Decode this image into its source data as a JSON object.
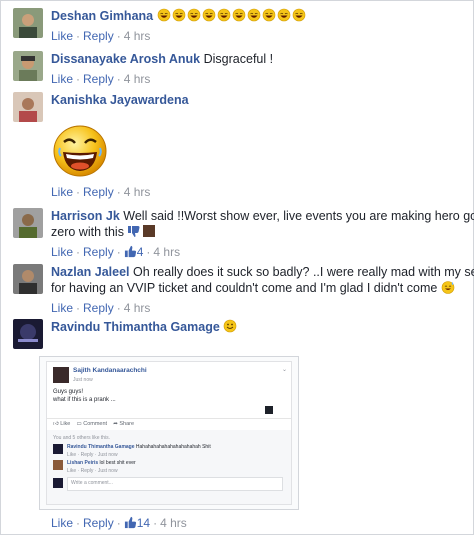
{
  "comments": [
    {
      "name": "Deshan Gimhana",
      "text": "",
      "emoji_count": 10,
      "time": "4 hrs"
    },
    {
      "name": "Dissanayake Arosh Anuk",
      "text": "Disgraceful !",
      "time": "4 hrs"
    },
    {
      "name": "Kanishka Jayawardena",
      "text": "",
      "time": "4 hrs"
    },
    {
      "name": "Harrison Jk",
      "text_line1": "Well said !!Worst show ever, live events you are making hero go",
      "text_line2": "zero with this",
      "likes": "4",
      "time": "4 hrs"
    },
    {
      "name": "Nazlan Jaleel",
      "text_line1": "Oh really does it suck so badly? ..I were really mad with my self",
      "text_line2": "for having an VVIP ticket and couldn't come and I'm glad I didn't come",
      "time": "4 hrs"
    },
    {
      "name": "Ravindu Thimantha Gamage",
      "text": "",
      "likes": "14",
      "time": "4 hrs"
    }
  ],
  "actions": {
    "like": "Like",
    "reply": "Reply",
    "dot": "·"
  },
  "avatar_colors": [
    "#3b4a3a",
    "#6b7b5a",
    "#b34a4a",
    "#556b2f",
    "#2f2f2f",
    "#1a1a33"
  ],
  "embedded_post": {
    "author": "Sajith Kandanaarachchi",
    "meta": "Just now",
    "line1": "Guys guys!",
    "line2": "what if this is a prank ...",
    "like": "Like",
    "comment": "Comment",
    "share": "Share",
    "likers": "You and 5 others like this.",
    "reply1_name": "Ravindu Thimantha Gamage",
    "reply1_text": "Hahahahahahahahahahahah",
    "reply1_extra": "Shit",
    "reply1_meta": "Like · Reply · Just now",
    "reply2_name": "Lishan Peiris",
    "reply2_text": "lol best shit ever",
    "reply2_meta": "Like · Reply · Just now",
    "write_placeholder": "Write a comment..."
  },
  "icons": {
    "smiley": "smiley-icon",
    "thumbs_up": "thumbs-up-icon",
    "thumbs_down": "thumbs-down-icon"
  },
  "colors": {
    "link": "#365899",
    "action": "#4267b2",
    "meta": "#90949c",
    "emoji": "#f5c518"
  }
}
